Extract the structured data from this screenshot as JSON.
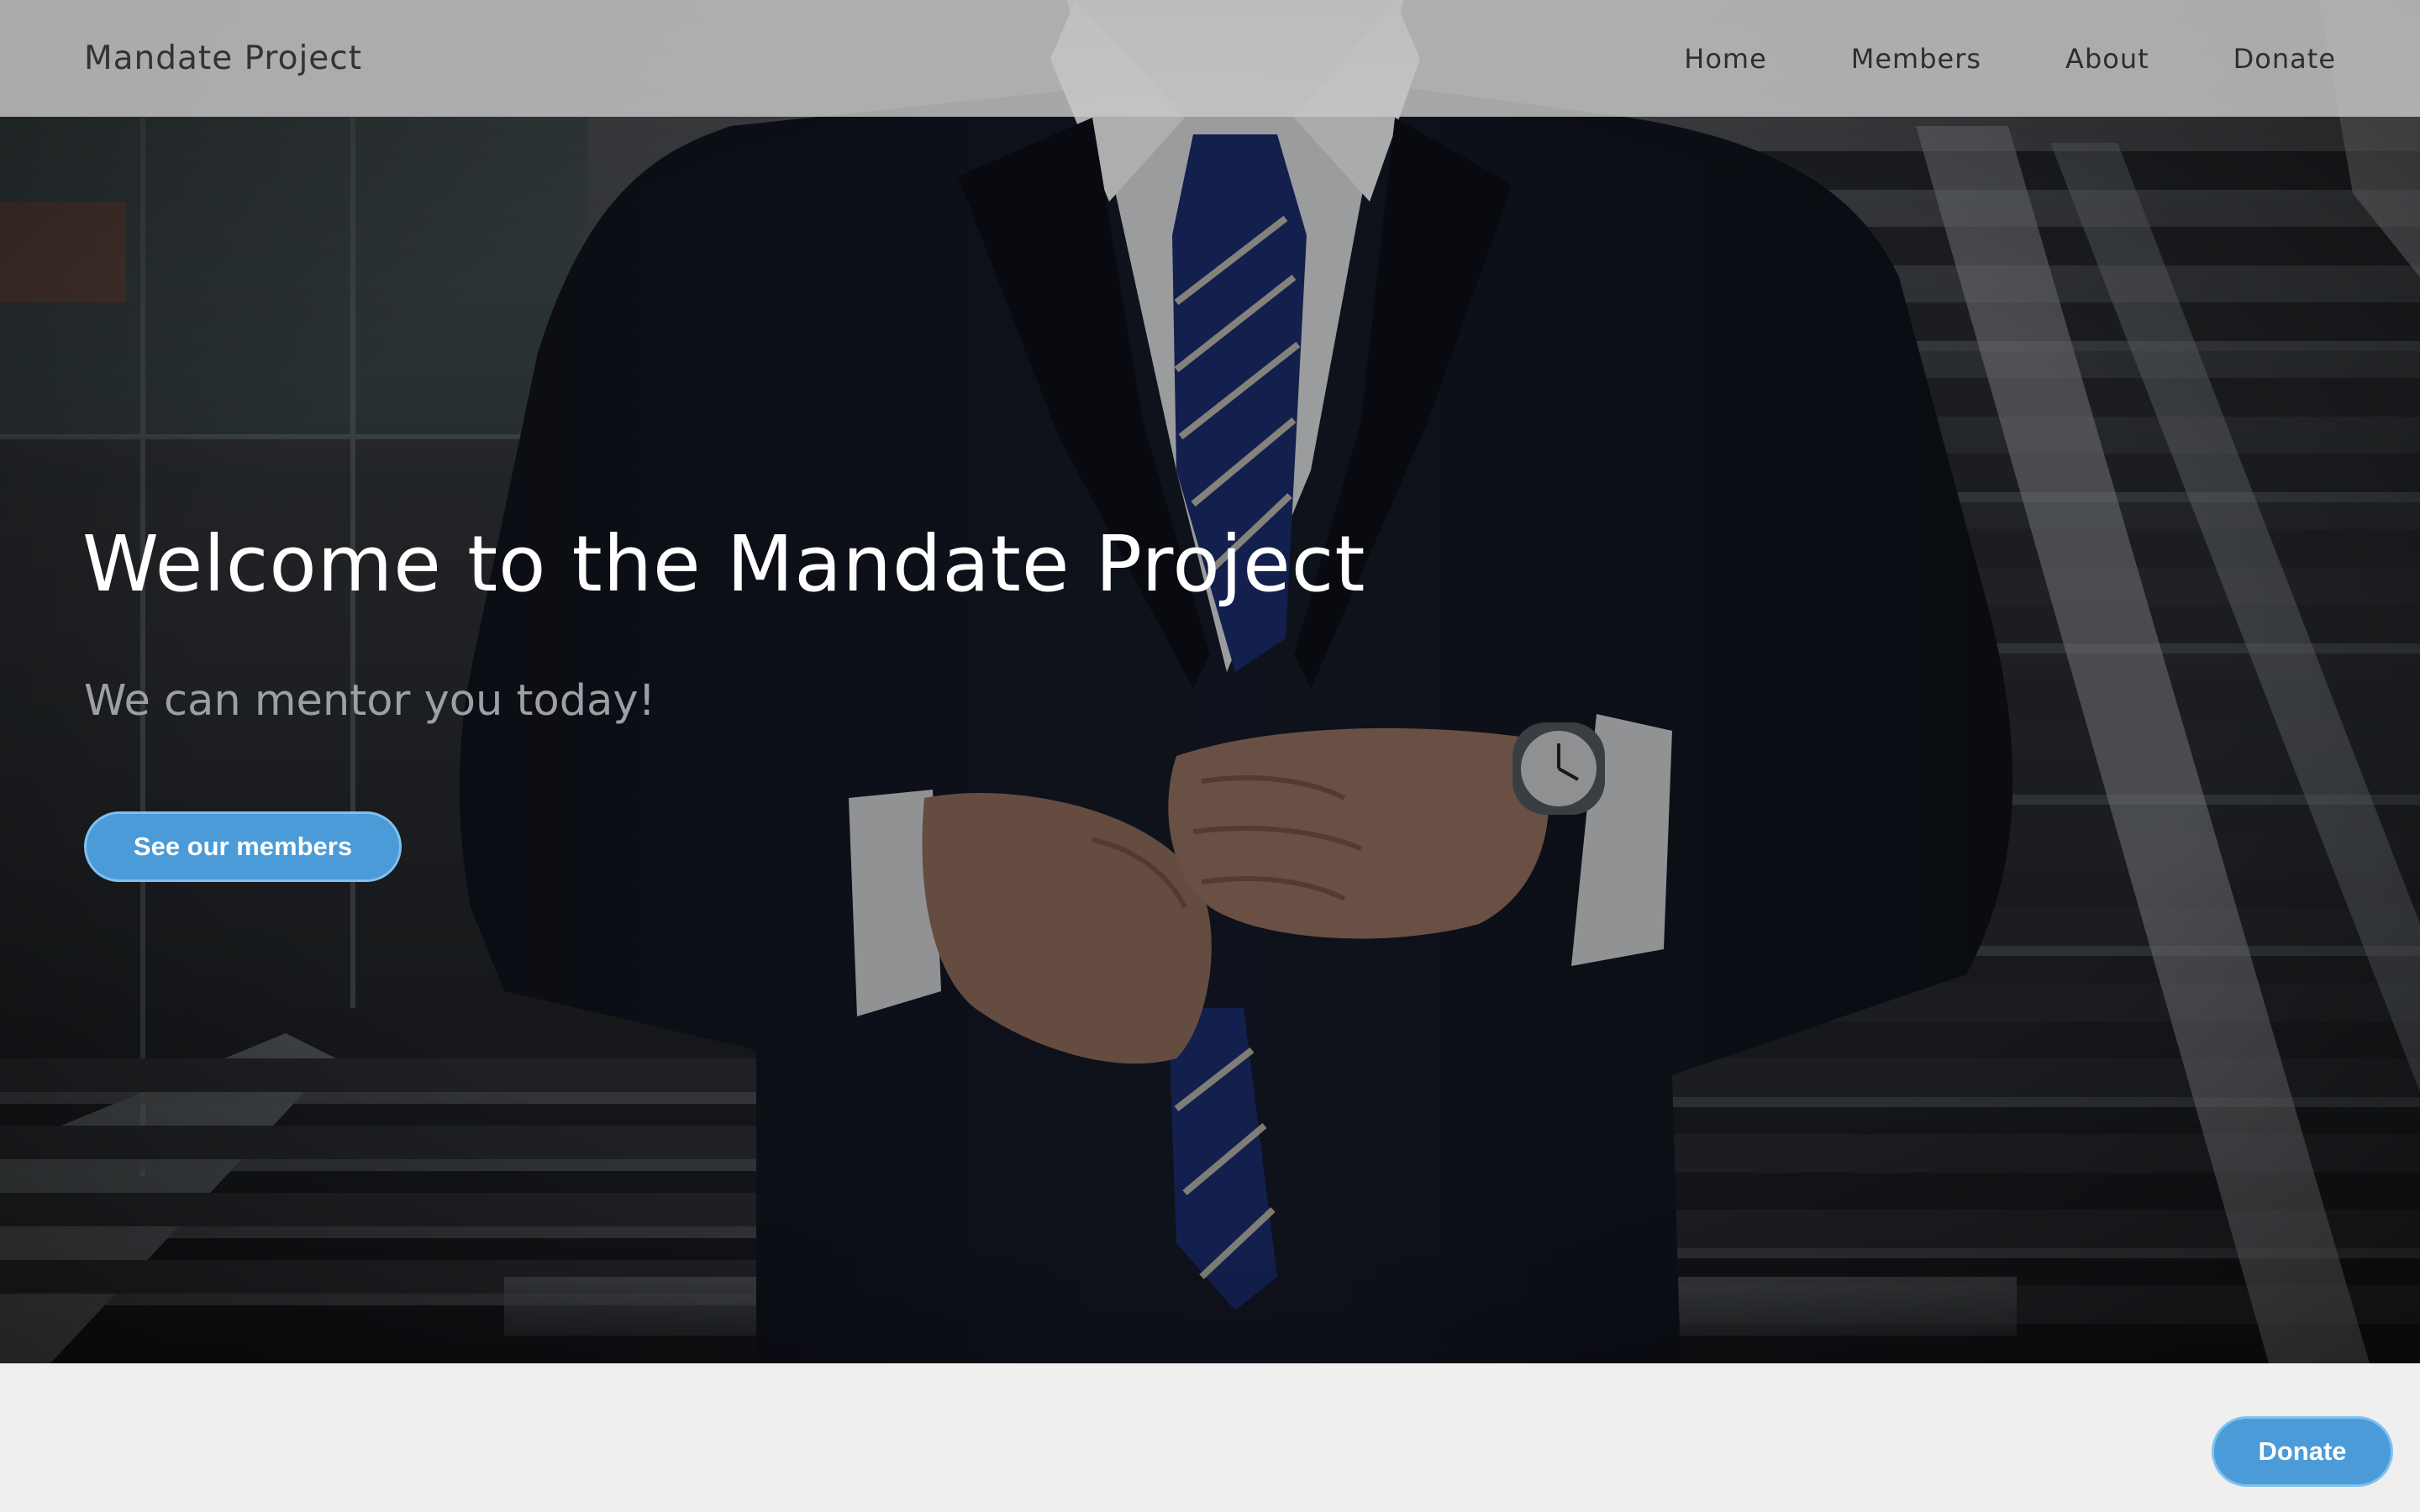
{
  "navbar": {
    "brand": "Mandate Project",
    "links": [
      {
        "label": "Home"
      },
      {
        "label": "Members"
      },
      {
        "label": "About"
      },
      {
        "label": "Donate"
      }
    ]
  },
  "hero": {
    "title": "Welcome to the Mandate Project",
    "subtitle": "We can mentor you today!",
    "cta_label": "See our members"
  },
  "floating_button": {
    "label": "Donate"
  },
  "colors": {
    "accent": "#4b9bd8",
    "accent_border": "#7fc0ee",
    "navbar_bg": "#c8c8c8",
    "page_bg": "#efefef",
    "subtitle": "#9d9fa3"
  }
}
